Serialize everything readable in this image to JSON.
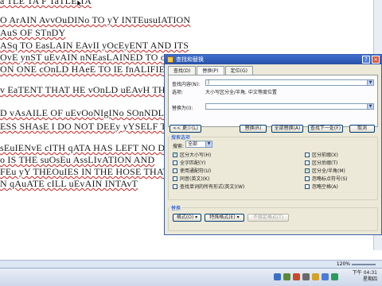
{
  "document": {
    "lines": [
      "a TLE TA F TaTLE TA",
      "O ArAIN AvvOuDINo TO yY INTEusuIATION",
      "AuS OF STnDY",
      "ASq TO EasLAIN EAvII yOcEyENT AND ITS",
      "OvE ynST uEvAIN nNEasLAINED TO oIeEA",
      "ON ONE cOnLD HAeE TO IE fnALIFIED",
      "v EaTENT THAT HE vOnLD uEAvH THE",
      "D vAsAILE OF uEvOoNIgINo SOnNDLES",
      "ESS SHAsE I DO NOT DEEy yYSELF THE",
      "sEuIENvE cITH qATA HAS LEFT NO DO",
      "o IS THE suOsEu AssLIvATION AND",
      "FEu yY THEOuIES IN THE HOSE THAT",
      "N qAuATE cILL uEvAIN INTAvT"
    ]
  },
  "dialog": {
    "title": "查找和替换",
    "help": "?",
    "close": "×",
    "tabs": [
      "查找(D)",
      "替换(P)",
      "定位(G)"
    ],
    "find_label": "查找内容(N):",
    "find_value": "|",
    "options_label": "选项:",
    "options_value": "大小写区分全/半角, 中文等度位置",
    "replace_label": "替换为(I):",
    "replace_value": "",
    "buttons": {
      "less": "<< 更少(L)",
      "replace": "替换(R)",
      "replace_all": "全部替换(A)",
      "find_next": "查找下一处(F)",
      "cancel": "取消"
    },
    "search_options_title": "搜索选项",
    "search_label": "搜索:",
    "search_value": "全部",
    "checkboxes_left": [
      {
        "label": "区分大小写(H)",
        "checked": true
      },
      {
        "label": "全字匹配(Y)",
        "checked": false
      },
      {
        "label": "使用通配符(U)",
        "checked": false
      },
      {
        "label": "同音(英文)(K)",
        "checked": false
      },
      {
        "label": "查找单词的所有形式(英文)(W)",
        "checked": false
      }
    ],
    "checkboxes_right": [
      {
        "label": "区分前缀(X)",
        "checked": false
      },
      {
        "label": "区分后缀(T)",
        "checked": false
      },
      {
        "label": "区分全/半角(M)",
        "checked": true
      },
      {
        "label": "忽略标点符号(S)",
        "checked": false
      },
      {
        "label": "忽略空格(A)",
        "checked": false
      }
    ],
    "replace_section_title": "替换",
    "format_button": "格式(O) ▾",
    "special_button": "特殊格式(E) ▾",
    "no_format_button": "不限定格式(T)"
  },
  "statusbar": {
    "zoom": "120%"
  },
  "taskbar": {
    "time": "下午 04:31",
    "date": "星期四"
  },
  "colors": {
    "accent": "#2751a8",
    "spell_error": "#d02020",
    "dialog_bg": "#ece9d8"
  }
}
